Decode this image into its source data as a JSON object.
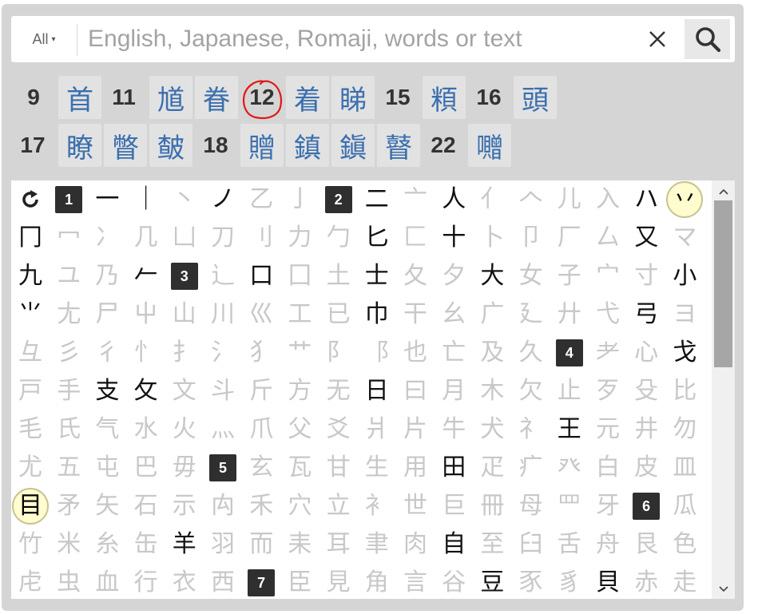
{
  "search": {
    "filter_label": "All",
    "filter_arrow": "▾",
    "placeholder": "English, Japanese, Romaji, words or text",
    "value": "",
    "clear_symbol": "✕"
  },
  "selected_groups": [
    {
      "strokes": "9",
      "kanji": [
        "首"
      ]
    },
    {
      "strokes": "11",
      "kanji": [
        "馗",
        "眷"
      ]
    },
    {
      "strokes": "12",
      "kanji": [
        "着",
        "睇"
      ]
    },
    {
      "strokes": "15",
      "kanji": [
        "頪"
      ]
    },
    {
      "strokes": "16",
      "kanji": [
        "頭"
      ]
    },
    {
      "strokes": "17",
      "kanji": [
        "瞭",
        "瞥",
        "皶"
      ]
    },
    {
      "strokes": "18",
      "kanji": [
        "贈",
        "鎮",
        "鎭",
        "瞽"
      ]
    },
    {
      "strokes": "22",
      "kanji": [
        "囎"
      ]
    }
  ],
  "radicals": {
    "reset_symbol": "⟳",
    "scroll_fraction": 0.63,
    "cells": [
      {
        "t": "1",
        "k": "badge"
      },
      {
        "t": "一",
        "k": "on"
      },
      {
        "t": "｜",
        "k": "on"
      },
      {
        "t": "丶",
        "k": "off"
      },
      {
        "t": "ノ",
        "k": "on"
      },
      {
        "t": "乙",
        "k": "off"
      },
      {
        "t": "亅",
        "k": "off"
      },
      {
        "t": "2",
        "k": "badge"
      },
      {
        "t": "二",
        "k": "on"
      },
      {
        "t": "亠",
        "k": "off"
      },
      {
        "t": "人",
        "k": "on"
      },
      {
        "t": "亻",
        "k": "off"
      },
      {
        "t": "𠆢",
        "k": "off"
      },
      {
        "t": "儿",
        "k": "off"
      },
      {
        "t": "入",
        "k": "off"
      },
      {
        "t": "ハ",
        "k": "on"
      },
      {
        "t": "丷",
        "k": "hl"
      },
      {
        "t": "冂",
        "k": "on"
      },
      {
        "t": "冖",
        "k": "off"
      },
      {
        "t": "冫",
        "k": "off"
      },
      {
        "t": "几",
        "k": "off"
      },
      {
        "t": "凵",
        "k": "off"
      },
      {
        "t": "刀",
        "k": "off"
      },
      {
        "t": "刂",
        "k": "off"
      },
      {
        "t": "力",
        "k": "off"
      },
      {
        "t": "勹",
        "k": "off"
      },
      {
        "t": "匕",
        "k": "on"
      },
      {
        "t": "匚",
        "k": "off"
      },
      {
        "t": "十",
        "k": "on"
      },
      {
        "t": "卜",
        "k": "off"
      },
      {
        "t": "卩",
        "k": "off"
      },
      {
        "t": "厂",
        "k": "off"
      },
      {
        "t": "厶",
        "k": "off"
      },
      {
        "t": "又",
        "k": "on"
      },
      {
        "t": "マ",
        "k": "off"
      },
      {
        "t": "九",
        "k": "on"
      },
      {
        "t": "ユ",
        "k": "off"
      },
      {
        "t": "乃",
        "k": "off"
      },
      {
        "t": "𠂉",
        "k": "on"
      },
      {
        "t": "3",
        "k": "badge"
      },
      {
        "t": "⻌",
        "k": "off"
      },
      {
        "t": "口",
        "k": "on"
      },
      {
        "t": "囗",
        "k": "off"
      },
      {
        "t": "土",
        "k": "off"
      },
      {
        "t": "士",
        "k": "on"
      },
      {
        "t": "夂",
        "k": "off"
      },
      {
        "t": "夕",
        "k": "off"
      },
      {
        "t": "大",
        "k": "on"
      },
      {
        "t": "女",
        "k": "off"
      },
      {
        "t": "子",
        "k": "off"
      },
      {
        "t": "宀",
        "k": "off"
      },
      {
        "t": "寸",
        "k": "off"
      },
      {
        "t": "小",
        "k": "on"
      },
      {
        "t": "⺌",
        "k": "on"
      },
      {
        "t": "尢",
        "k": "off"
      },
      {
        "t": "尸",
        "k": "off"
      },
      {
        "t": "屮",
        "k": "off"
      },
      {
        "t": "山",
        "k": "off"
      },
      {
        "t": "川",
        "k": "off"
      },
      {
        "t": "巛",
        "k": "off"
      },
      {
        "t": "工",
        "k": "off"
      },
      {
        "t": "已",
        "k": "off"
      },
      {
        "t": "巾",
        "k": "on"
      },
      {
        "t": "干",
        "k": "off"
      },
      {
        "t": "幺",
        "k": "off"
      },
      {
        "t": "广",
        "k": "off"
      },
      {
        "t": "廴",
        "k": "off"
      },
      {
        "t": "廾",
        "k": "off"
      },
      {
        "t": "弋",
        "k": "off"
      },
      {
        "t": "弓",
        "k": "on"
      },
      {
        "t": "ヨ",
        "k": "off"
      },
      {
        "t": "彑",
        "k": "off"
      },
      {
        "t": "彡",
        "k": "off"
      },
      {
        "t": "彳",
        "k": "off"
      },
      {
        "t": "忄",
        "k": "off"
      },
      {
        "t": "扌",
        "k": "off"
      },
      {
        "t": "氵",
        "k": "off"
      },
      {
        "t": "犭",
        "k": "off"
      },
      {
        "t": "艹",
        "k": "off"
      },
      {
        "t": "⻖",
        "k": "off"
      },
      {
        "t": "⻏",
        "k": "off"
      },
      {
        "t": "也",
        "k": "off"
      },
      {
        "t": "亡",
        "k": "off"
      },
      {
        "t": "及",
        "k": "off"
      },
      {
        "t": "久",
        "k": "off"
      },
      {
        "t": "4",
        "k": "badge"
      },
      {
        "t": "耂",
        "k": "off"
      },
      {
        "t": "心",
        "k": "off"
      },
      {
        "t": "戈",
        "k": "on"
      },
      {
        "t": "戸",
        "k": "off"
      },
      {
        "t": "手",
        "k": "off"
      },
      {
        "t": "支",
        "k": "on"
      },
      {
        "t": "攵",
        "k": "on"
      },
      {
        "t": "文",
        "k": "off"
      },
      {
        "t": "斗",
        "k": "off"
      },
      {
        "t": "斤",
        "k": "off"
      },
      {
        "t": "方",
        "k": "off"
      },
      {
        "t": "无",
        "k": "off"
      },
      {
        "t": "日",
        "k": "on"
      },
      {
        "t": "曰",
        "k": "off"
      },
      {
        "t": "月",
        "k": "off"
      },
      {
        "t": "木",
        "k": "off"
      },
      {
        "t": "欠",
        "k": "off"
      },
      {
        "t": "止",
        "k": "off"
      },
      {
        "t": "歹",
        "k": "off"
      },
      {
        "t": "殳",
        "k": "off"
      },
      {
        "t": "比",
        "k": "off"
      },
      {
        "t": "毛",
        "k": "off"
      },
      {
        "t": "氏",
        "k": "off"
      },
      {
        "t": "气",
        "k": "off"
      },
      {
        "t": "水",
        "k": "off"
      },
      {
        "t": "火",
        "k": "off"
      },
      {
        "t": "灬",
        "k": "off"
      },
      {
        "t": "爪",
        "k": "off"
      },
      {
        "t": "父",
        "k": "off"
      },
      {
        "t": "爻",
        "k": "off"
      },
      {
        "t": "爿",
        "k": "off"
      },
      {
        "t": "片",
        "k": "off"
      },
      {
        "t": "牛",
        "k": "off"
      },
      {
        "t": "犬",
        "k": "off"
      },
      {
        "t": "礻",
        "k": "off"
      },
      {
        "t": "王",
        "k": "on"
      },
      {
        "t": "元",
        "k": "off"
      },
      {
        "t": "井",
        "k": "off"
      },
      {
        "t": "勿",
        "k": "off"
      },
      {
        "t": "尤",
        "k": "off"
      },
      {
        "t": "五",
        "k": "off"
      },
      {
        "t": "屯",
        "k": "off"
      },
      {
        "t": "巴",
        "k": "off"
      },
      {
        "t": "毋",
        "k": "off"
      },
      {
        "t": "5",
        "k": "badge"
      },
      {
        "t": "玄",
        "k": "off"
      },
      {
        "t": "瓦",
        "k": "off"
      },
      {
        "t": "甘",
        "k": "off"
      },
      {
        "t": "生",
        "k": "off"
      },
      {
        "t": "用",
        "k": "off"
      },
      {
        "t": "田",
        "k": "on"
      },
      {
        "t": "疋",
        "k": "off"
      },
      {
        "t": "疒",
        "k": "off"
      },
      {
        "t": "癶",
        "k": "off"
      },
      {
        "t": "白",
        "k": "off"
      },
      {
        "t": "皮",
        "k": "off"
      },
      {
        "t": "皿",
        "k": "off"
      },
      {
        "t": "目",
        "k": "hl"
      },
      {
        "t": "矛",
        "k": "off"
      },
      {
        "t": "矢",
        "k": "off"
      },
      {
        "t": "石",
        "k": "off"
      },
      {
        "t": "示",
        "k": "off"
      },
      {
        "t": "禸",
        "k": "off"
      },
      {
        "t": "禾",
        "k": "off"
      },
      {
        "t": "穴",
        "k": "off"
      },
      {
        "t": "立",
        "k": "off"
      },
      {
        "t": "衤",
        "k": "off"
      },
      {
        "t": "世",
        "k": "off"
      },
      {
        "t": "巨",
        "k": "off"
      },
      {
        "t": "冊",
        "k": "off"
      },
      {
        "t": "母",
        "k": "off"
      },
      {
        "t": "罒",
        "k": "off"
      },
      {
        "t": "牙",
        "k": "off"
      },
      {
        "t": "6",
        "k": "badge"
      },
      {
        "t": "瓜",
        "k": "off"
      },
      {
        "t": "竹",
        "k": "off"
      },
      {
        "t": "米",
        "k": "off"
      },
      {
        "t": "糸",
        "k": "off"
      },
      {
        "t": "缶",
        "k": "off"
      },
      {
        "t": "羊",
        "k": "on"
      },
      {
        "t": "羽",
        "k": "off"
      },
      {
        "t": "而",
        "k": "off"
      },
      {
        "t": "耒",
        "k": "off"
      },
      {
        "t": "耳",
        "k": "off"
      },
      {
        "t": "聿",
        "k": "off"
      },
      {
        "t": "肉",
        "k": "off"
      },
      {
        "t": "自",
        "k": "on"
      },
      {
        "t": "至",
        "k": "off"
      },
      {
        "t": "臼",
        "k": "off"
      },
      {
        "t": "舌",
        "k": "off"
      },
      {
        "t": "舟",
        "k": "off"
      },
      {
        "t": "艮",
        "k": "off"
      },
      {
        "t": "色",
        "k": "off"
      },
      {
        "t": "虍",
        "k": "off"
      },
      {
        "t": "虫",
        "k": "off"
      },
      {
        "t": "血",
        "k": "off"
      },
      {
        "t": "行",
        "k": "off"
      },
      {
        "t": "衣",
        "k": "off"
      },
      {
        "t": "西",
        "k": "off"
      },
      {
        "t": "7",
        "k": "badge"
      },
      {
        "t": "臣",
        "k": "off"
      },
      {
        "t": "見",
        "k": "off"
      },
      {
        "t": "角",
        "k": "off"
      },
      {
        "t": "言",
        "k": "off"
      },
      {
        "t": "谷",
        "k": "off"
      },
      {
        "t": "豆",
        "k": "on"
      },
      {
        "t": "豕",
        "k": "off"
      },
      {
        "t": "豸",
        "k": "off"
      },
      {
        "t": "貝",
        "k": "on"
      },
      {
        "t": "赤",
        "k": "off"
      },
      {
        "t": "走",
        "k": "off"
      }
    ]
  },
  "colors": {
    "frame": "#d5d5d5",
    "kanji_link": "#3b6fae",
    "annotation": "#e01818"
  }
}
